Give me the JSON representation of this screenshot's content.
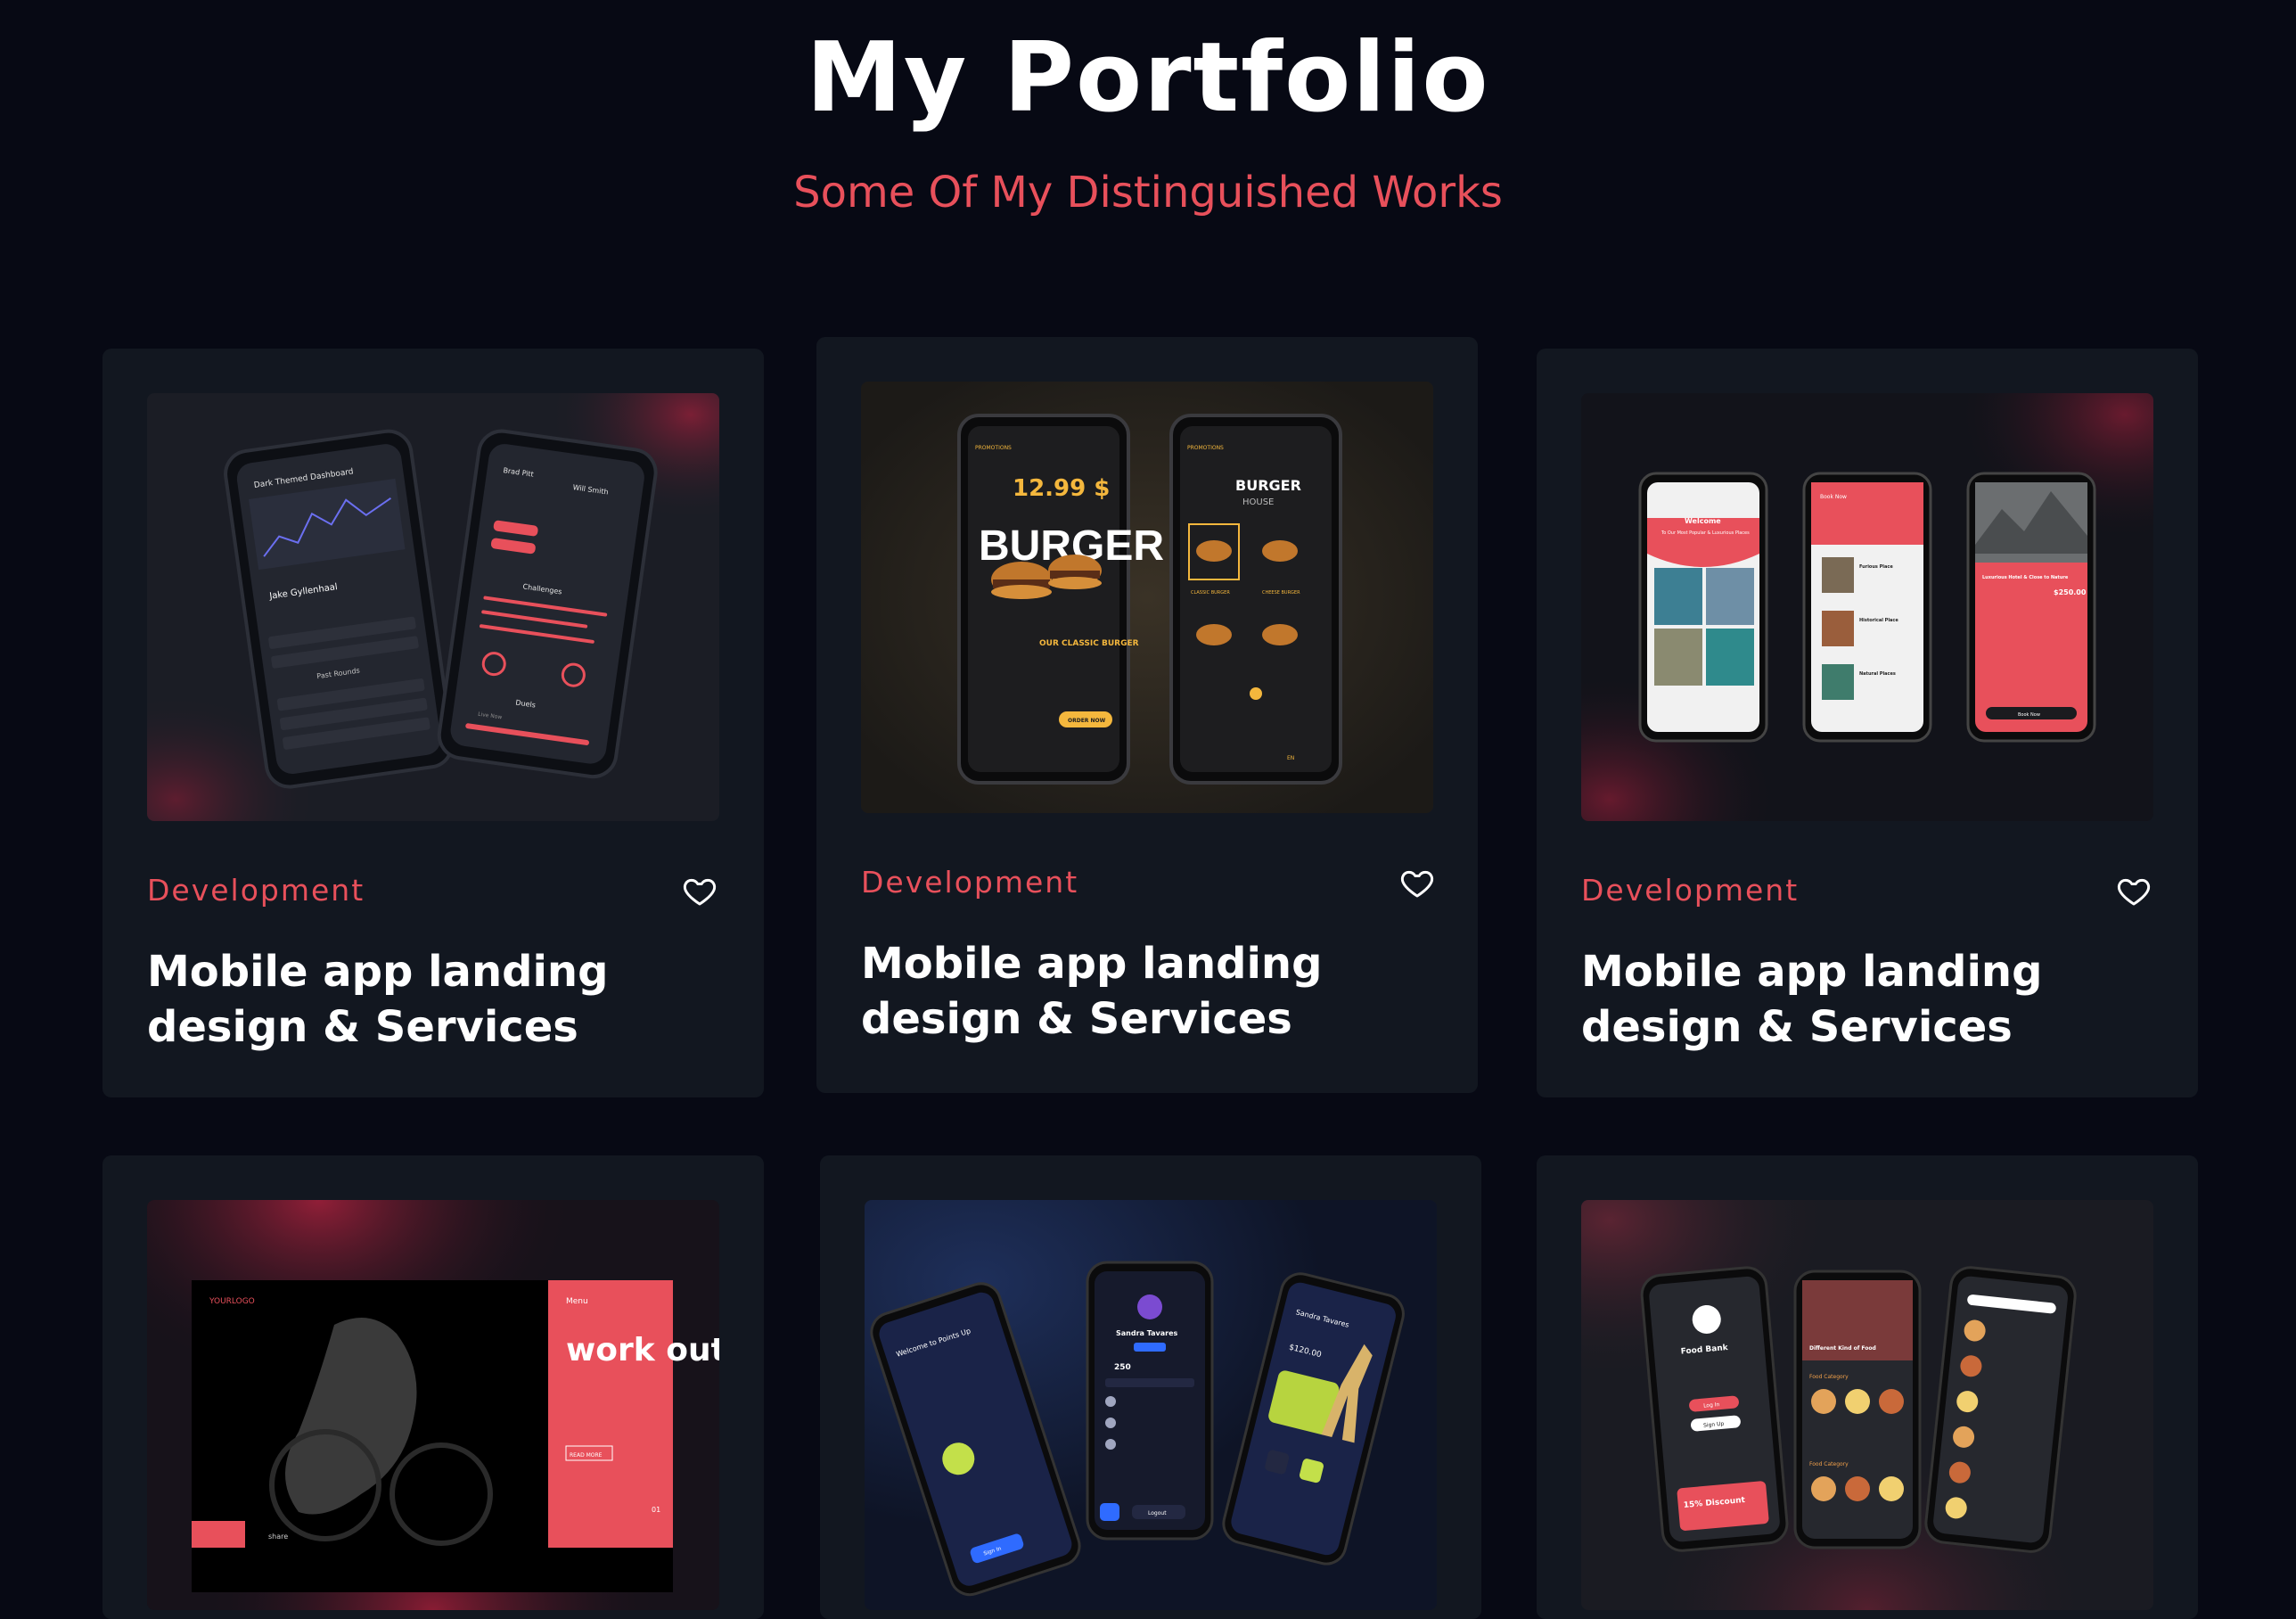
{
  "header": {
    "title": "My Portfolio",
    "subtitle": "Some Of My Distinguished Works"
  },
  "colors": {
    "background": "#070914",
    "card": "#121720",
    "accent": "#e8505b",
    "gold": "#f4b73d"
  },
  "cards": [
    {
      "category": "Development",
      "title": "Mobile app landing design & Services",
      "icon": "heart-icon",
      "thumb_texts": [
        "Dark Themed Dashboard",
        "Jake Gyllenhaal",
        "Brad Pitt",
        "Will Smith",
        "Challenges",
        "Past Rounds",
        "Duels",
        "Live Now"
      ]
    },
    {
      "category": "Development",
      "title": "Mobile app landing design & Services",
      "icon": "heart-icon",
      "thumb_texts": [
        "PROMOTIONS",
        "12.99 $",
        "BURGER",
        "OUR CLASSIC BURGER",
        "ORDER NOW",
        "BURGER",
        "HOUSE",
        "CLASSIC BURGER",
        "CHEESE BURGER",
        "EN"
      ]
    },
    {
      "category": "Development",
      "title": "Mobile app landing design & Services",
      "icon": "heart-icon",
      "thumb_texts": [
        "Welcome",
        "To Our Most Popular & Luxurious Places",
        "Book Now",
        "Furious Place",
        "Historical Place",
        "Natural Places",
        "Luxurious Hotel & Close to Nature",
        "$250.00",
        "Book Now"
      ]
    },
    {
      "category": "",
      "title": "",
      "icon": "heart-icon",
      "thumb_texts": [
        "YOURLOGO",
        "Menu",
        "work out",
        "READ MORE",
        "share",
        "01"
      ]
    },
    {
      "category": "",
      "title": "",
      "icon": "heart-icon",
      "thumb_texts": [
        "Welcome to Points Up",
        "Sandra Tavares",
        "250",
        "Sandra Tavares",
        "$120.00",
        "Logout",
        "Sign In"
      ]
    },
    {
      "category": "",
      "title": "",
      "icon": "heart-icon",
      "thumb_texts": [
        "Food Bank",
        "Log In",
        "Sign Up",
        "15% Discount",
        "Different Kind of Food",
        "Food Category",
        "Food Category"
      ]
    }
  ]
}
